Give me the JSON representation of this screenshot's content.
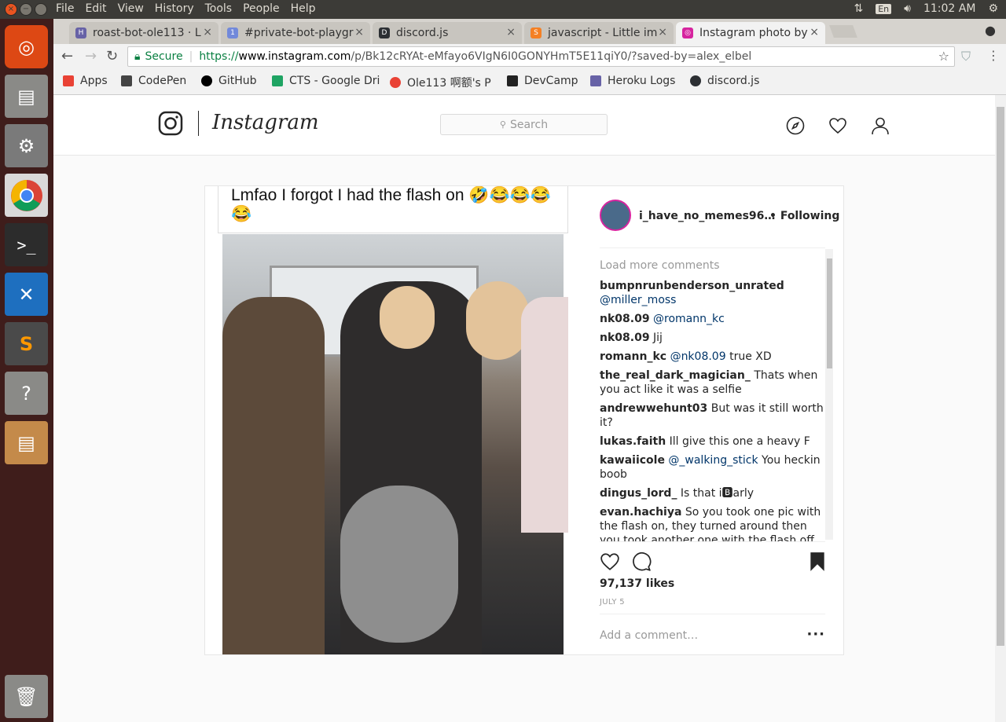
{
  "system": {
    "menu": [
      "File",
      "Edit",
      "View",
      "History",
      "Tools",
      "People",
      "Help"
    ],
    "lang": "En",
    "time": "11:02 AM"
  },
  "tabs": [
    {
      "title": "roast-bot-ole113 · L",
      "fav_color": "#6762a6",
      "fav_glyph": "H"
    },
    {
      "title": "#private-bot-playgr",
      "fav_color": "#7289da",
      "fav_glyph": "1"
    },
    {
      "title": "discord.js",
      "fav_color": "#2c2f33",
      "fav_glyph": "DJS"
    },
    {
      "title": "javascript - Little im",
      "fav_color": "#f48024",
      "fav_glyph": "S"
    },
    {
      "title": "Instagram photo by",
      "fav_color": "#d6249f",
      "fav_glyph": "I"
    }
  ],
  "address": {
    "secure_label": "Secure",
    "url_scheme": "https://",
    "url_host": "www.instagram.com",
    "url_path": "/p/Bk12cRYAt-eMfayo6VIgN6I0GONYHmT5E11qiY0/?saved-by=alex_elbel"
  },
  "bookmarks": [
    {
      "label": "Apps",
      "color": "#e94235"
    },
    {
      "label": "CodePen",
      "color": "#444"
    },
    {
      "label": "GitHub",
      "color": "#000"
    },
    {
      "label": "CTS - Google Dri",
      "color": "#1fa463"
    },
    {
      "label": "Ole113 啊额's P",
      "color": "#e94235"
    },
    {
      "label": "DevCamp",
      "color": "#222"
    },
    {
      "label": "Heroku Logs",
      "color": "#6762a6"
    },
    {
      "label": "discord.js",
      "color": "#2c2f33"
    }
  ],
  "instagram": {
    "wordmark": "Instagram",
    "search_placeholder": "Search"
  },
  "post": {
    "caption": "Lmfao I forgot I had the flash on 🤣😂😂😂 😂",
    "username": "i_have_no_memes96…",
    "follow_status": "• Following",
    "load_more": "Load more comments",
    "comments": [
      {
        "user": "bumpnrunbenderson_unrated",
        "mention": "@miller_moss",
        "text": ""
      },
      {
        "user": "nk08.09",
        "mention": "@romann_kc",
        "text": ""
      },
      {
        "user": "nk08.09",
        "mention": "",
        "text": "Jij"
      },
      {
        "user": "romann_kc",
        "mention": "@nk08.09",
        "text": "true XD"
      },
      {
        "user": "the_real_dark_magician_",
        "mention": "",
        "text": "Thats when you act like it was a selfie"
      },
      {
        "user": "andrewwehunt03",
        "mention": "",
        "text": "But was it still worth it?"
      },
      {
        "user": "lukas.faith",
        "mention": "",
        "text": "Ill give this one a heavy F"
      },
      {
        "user": "kawaiicole",
        "mention": "@_walking_stick",
        "text": "You heckin boob"
      },
      {
        "user": "dingus_lord_",
        "mention": "",
        "text": "Is that i🅱arly"
      },
      {
        "user": "evan.hachiya",
        "mention": "",
        "text": "So you took one pic with the flash on, they turned around then you took another one with the flash off then posted it."
      }
    ],
    "likes": "97,137 likes",
    "date": "JULY 5",
    "add_comment_placeholder": "Add a comment…"
  }
}
